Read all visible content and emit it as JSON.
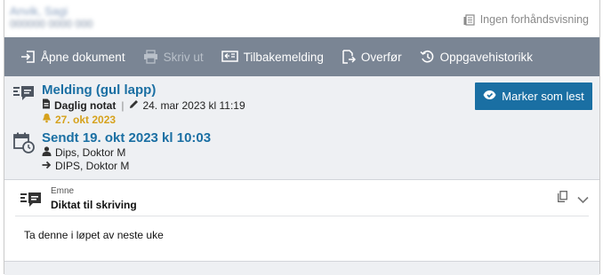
{
  "header": {
    "blurred_line1": "Anvik, Sagi",
    "blurred_line2": "000000 0000 000",
    "preview_toggle_label": "Ingen forhåndsvisning"
  },
  "toolbar": {
    "open_document": "Åpne dokument",
    "print": "Skriv ut",
    "reply": "Tilbakemelding",
    "forward": "Overfør",
    "task_history": "Oppgavehistorikk"
  },
  "message": {
    "title": "Melding (gul lapp)",
    "doc_type": "Daglig notat",
    "edited": "24. mar 2023 kl 11:19",
    "alarm_date": "27. okt 2023",
    "mark_read_label": "Marker som lest"
  },
  "sent": {
    "title": "Sendt 19. okt 2023 kl 10:03",
    "from": "Dips, Doktor M",
    "to": "DIPS, Doktor M"
  },
  "content": {
    "subject_label": "Emne",
    "subject_value": "Diktat til skriving",
    "body": "Ta denne i løpet av neste uke"
  },
  "colors": {
    "toolbar_bg": "#7a8594",
    "accent": "#1a6fa3",
    "alarm": "#d6a21d",
    "summary_bg": "#eef0f3"
  }
}
